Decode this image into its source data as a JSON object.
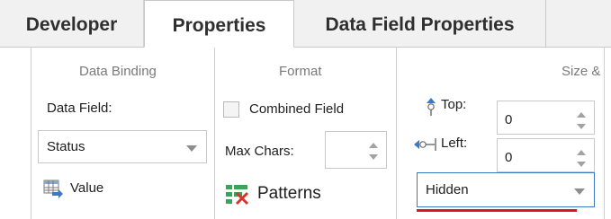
{
  "tabs": [
    {
      "label": "Developer"
    },
    {
      "label": "Properties"
    },
    {
      "label": "Data Field Properties"
    }
  ],
  "groups": {
    "data_binding": {
      "title": "Data Binding",
      "data_field_label": "Data Field:",
      "data_field_value": "Status",
      "value_label": "Value"
    },
    "format": {
      "title": "Format",
      "combined_field_label": "Combined Field",
      "max_chars_label": "Max Chars:",
      "max_chars_value": "",
      "patterns_label": "Patterns"
    },
    "size": {
      "title": "Size &",
      "top_label": "Top:",
      "top_value": "0",
      "left_label": "Left:",
      "left_value": "0",
      "visibility_value": "Hidden"
    }
  },
  "colors": {
    "highlight_underline": "#e0161b",
    "icon_blue": "#3a7ac8",
    "icon_green": "#3aa35c"
  },
  "icons": [
    "value-icon",
    "patterns-icon",
    "top-position-icon",
    "left-position-icon",
    "caret-down-icon"
  ]
}
